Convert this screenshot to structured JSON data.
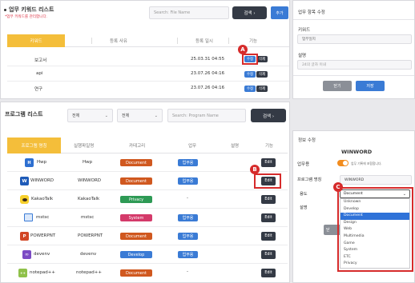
{
  "keyword_panel": {
    "title": "업무 키워드 리스트",
    "subtitle": "*업무 키워드를 관리합니다.",
    "search_placeholder": "Search: File Name",
    "search_label": "검색 ›",
    "add_label": "추가",
    "columns": [
      "키워드",
      "등록 사유",
      "등록 일시",
      "기능"
    ],
    "rows": [
      {
        "keyword": "보고서",
        "reason": "",
        "date": "25.03.31 04:55"
      },
      {
        "keyword": "api",
        "reason": "",
        "date": "23.07.26 04:16"
      },
      {
        "keyword": "연구",
        "reason": "",
        "date": "23.07.26 04:16"
      }
    ],
    "edit_label": "수정",
    "delete_label": "삭제"
  },
  "edit_panel": {
    "title": "업무 항목 수정",
    "keyword_label": "키워드",
    "keyword_value": "업무일지",
    "desc_label": "설명",
    "desc_placeholder": "24의 글자 이내",
    "close_label": "닫기",
    "save_label": "저장"
  },
  "program_panel": {
    "title": "프로그램 리스트",
    "filter1": "전체",
    "filter2": "전체",
    "search_placeholder": "Search: Program Name",
    "search_label": "검색 ›",
    "columns": [
      "프로그램 명칭",
      "실행파일명",
      "카테고리",
      "업무",
      "설명",
      "기능"
    ],
    "rows": [
      {
        "name": "Hwp",
        "exe": "Hwp",
        "category": "Document",
        "cat_color": "#d0581f",
        "work": "업무용",
        "desc": "",
        "icon": "hwp-icon"
      },
      {
        "name": "WINWORD",
        "exe": "WINWORD",
        "category": "Document",
        "cat_color": "#d0581f",
        "work": "업무용",
        "desc": "",
        "icon": "word-icon"
      },
      {
        "name": "KakaoTalk",
        "exe": "KakaoTalk",
        "category": "Privacy",
        "cat_color": "#2e9a55",
        "work": "",
        "desc": "-",
        "icon": "kakaotalk-icon"
      },
      {
        "name": "mstsc",
        "exe": "mstsc",
        "category": "System",
        "cat_color": "#d43a6a",
        "work": "업무용",
        "desc": "",
        "icon": "mstsc-icon"
      },
      {
        "name": "POWERPNT",
        "exe": "POWERPNT",
        "category": "Document",
        "cat_color": "#d0581f",
        "work": "업무용",
        "desc": "",
        "icon": "powerpoint-icon"
      },
      {
        "name": "devenv",
        "exe": "devenv",
        "category": "Develop",
        "cat_color": "#3a7bd5",
        "work": "업무용",
        "desc": "",
        "icon": "visual-studio-icon"
      },
      {
        "name": "notepad++",
        "exe": "notepad++",
        "category": "Document",
        "cat_color": "#d0581f",
        "work": "",
        "desc": "-",
        "icon": "notepad-icon"
      }
    ],
    "edit_label": "Edit"
  },
  "info_panel": {
    "title": "정보 수정",
    "program_name": "WINWORD",
    "work_label": "업무용",
    "toggle_text": "업무 기록에 포함합니다.",
    "name_label": "프로그램 명칭",
    "name_value": "WINWORD",
    "use_label": "용도",
    "use_value": "Document",
    "desc_label": "설명",
    "options": [
      "Unknown",
      "Develop",
      "Document",
      "Design",
      "Web",
      "Multimedia",
      "Game",
      "System",
      "ETC",
      "Privacy"
    ],
    "selected": "Document",
    "partial_button": "닫"
  },
  "markers": {
    "a": "A",
    "b": "B",
    "c": "C"
  }
}
